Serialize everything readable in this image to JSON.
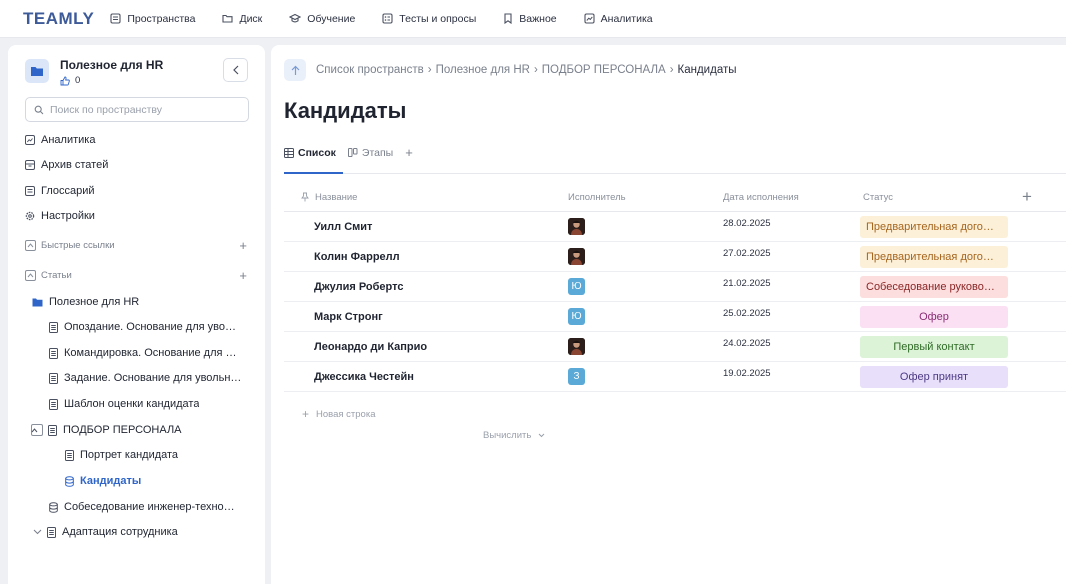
{
  "app": {
    "logo": "TEAMLY"
  },
  "topnav": [
    {
      "label": "Пространства",
      "icon": "spaces-icon"
    },
    {
      "label": "Диск",
      "icon": "folder-icon"
    },
    {
      "label": "Обучение",
      "icon": "graduation-icon"
    },
    {
      "label": "Тесты и опросы",
      "icon": "test-icon"
    },
    {
      "label": "Важное",
      "icon": "bookmark-icon"
    },
    {
      "label": "Аналитика",
      "icon": "chart-icon"
    }
  ],
  "sidebar": {
    "space_title": "Полезное для HR",
    "likes": "0",
    "search_placeholder": "Поиск по пространству",
    "menu": [
      {
        "label": "Аналитика",
        "icon": "chart-icon"
      },
      {
        "label": "Архив статей",
        "icon": "archive-icon"
      },
      {
        "label": "Глоссарий",
        "icon": "glossary-icon"
      },
      {
        "label": "Настройки",
        "icon": "settings-icon"
      }
    ],
    "section_links": "Быстрые ссылки",
    "section_articles": "Статьи",
    "tree": [
      {
        "label": "Полезное для HR"
      },
      {
        "label": "Опоздание. Основание для уво…"
      },
      {
        "label": "Командировка. Основание для …"
      },
      {
        "label": "Задание. Основание для увольн…"
      },
      {
        "label": "Шаблон оценки кандидата"
      },
      {
        "label": "ПОДБОР ПЕРСОНАЛА"
      },
      {
        "label": "Портрет кандидата"
      },
      {
        "label": "Кандидаты"
      },
      {
        "label": "Собеседование инженер-техно…"
      },
      {
        "label": "Адаптация сотрудника"
      }
    ]
  },
  "main": {
    "breadcrumb": [
      "Список пространств",
      "Полезное для HR",
      "ПОДБОР ПЕРСОНАЛА",
      "Кандидаты"
    ],
    "title": "Кандидаты",
    "tabs": [
      "Список",
      "Этапы"
    ],
    "columns": [
      "Название",
      "Исполнитель",
      "Дата исполнения",
      "Статус"
    ],
    "rows": [
      {
        "name": "Уилл Смит",
        "assignee": "photo",
        "date": "28.02.2025",
        "status": "Предварительная дого…",
        "status_bg": "#fdf0d8",
        "status_fg": "#a5651e",
        "center": false
      },
      {
        "name": "Колин Фаррелл",
        "assignee": "photo",
        "date": "27.02.2025",
        "status": "Предварительная дого…",
        "status_bg": "#fdf0d8",
        "status_fg": "#a5651e",
        "center": false
      },
      {
        "name": "Джулия Робертс",
        "assignee": "Ю",
        "date": "21.02.2025",
        "status": "Собеседование руково…",
        "status_bg": "#fcdede",
        "status_fg": "#8a2626",
        "center": false
      },
      {
        "name": "Марк Стронг",
        "assignee": "Ю",
        "date": "25.02.2025",
        "status": "Офер",
        "status_bg": "#fbe0f4",
        "status_fg": "#8a2e73",
        "center": true
      },
      {
        "name": "Леонардо ди Каприо",
        "assignee": "photo",
        "date": "24.02.2025",
        "status": "Первый контакт",
        "status_bg": "#dcf3d8",
        "status_fg": "#2f6b26",
        "center": true
      },
      {
        "name": "Джессика Честейн",
        "assignee": "З",
        "date": "19.02.2025",
        "status": "Офер принят",
        "status_bg": "#e8dffa",
        "status_fg": "#4d3a85",
        "center": true
      }
    ],
    "new_row": "Новая строка",
    "calculate": "Вычислить"
  }
}
